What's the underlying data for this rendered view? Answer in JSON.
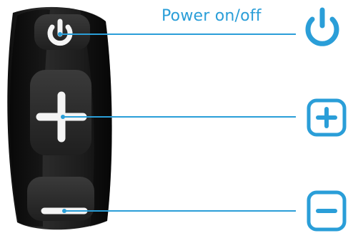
{
  "callouts": {
    "power_label": "Power on/off"
  },
  "buttons": [
    {
      "id": "power",
      "icon": "power-icon"
    },
    {
      "id": "plus",
      "icon": "plus-icon"
    },
    {
      "id": "minus",
      "icon": "minus-icon"
    }
  ],
  "colors": {
    "accent": "#2a9ed8",
    "remote_body": "#1b1b1b",
    "button_face": "#2a2a2a",
    "glyph": "#f4f4f4"
  }
}
